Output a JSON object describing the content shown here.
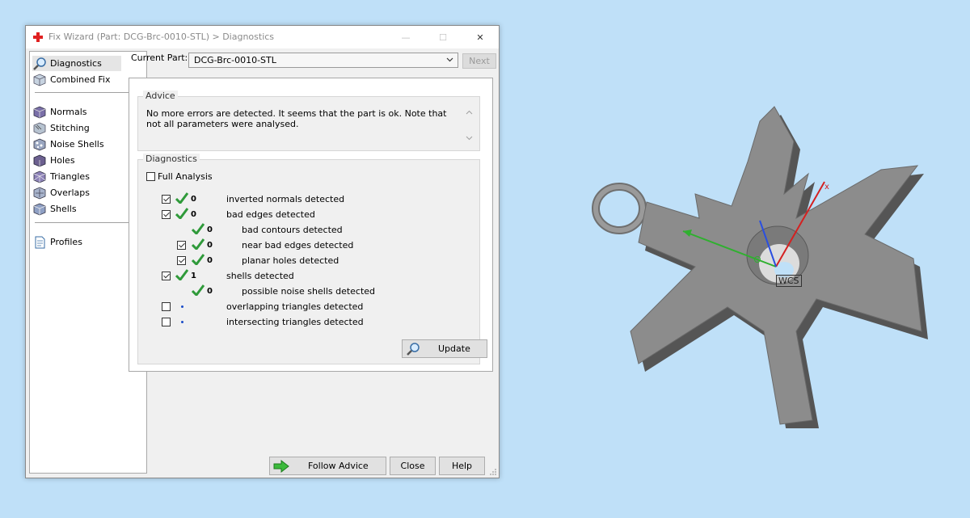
{
  "window": {
    "title": "Fix Wizard (Part: DCG-Brc-0010-STL) > Diagnostics",
    "minimize": "—",
    "maximize": "☐",
    "close": "✕"
  },
  "sidebar": {
    "items": [
      {
        "label": "Diagnostics",
        "icon": "magnifier-icon",
        "selected": true
      },
      {
        "label": "Combined Fix",
        "icon": "cube-icon"
      },
      {
        "label": "Normals",
        "icon": "cube-normals-icon"
      },
      {
        "label": "Stitching",
        "icon": "stitching-icon"
      },
      {
        "label": "Noise Shells",
        "icon": "noise-shells-icon"
      },
      {
        "label": "Holes",
        "icon": "holes-icon"
      },
      {
        "label": "Triangles",
        "icon": "triangles-icon"
      },
      {
        "label": "Overlaps",
        "icon": "overlaps-icon"
      },
      {
        "label": "Shells",
        "icon": "shells-icon"
      },
      {
        "label": "Profiles",
        "icon": "document-icon"
      }
    ]
  },
  "current_part": {
    "label": "Current Part:",
    "value": "DCG-Brc-0010-STL",
    "next_label": "Next"
  },
  "advice": {
    "title": "Advice",
    "text": "No more errors are detected. It seems that the part is ok. Note that not all parameters were analysed."
  },
  "diagnostics": {
    "title": "Diagnostics",
    "full_analysis_label": "Full Analysis",
    "rows": [
      {
        "label": "inverted normals detected",
        "count": "0",
        "checked": true
      },
      {
        "label": "bad edges detected",
        "count": "0",
        "checked": true
      },
      {
        "label": "bad contours detected",
        "count": "0",
        "checked": false
      },
      {
        "label": "near bad edges detected",
        "count": "0",
        "checked": true
      },
      {
        "label": "planar holes detected",
        "count": "0",
        "checked": true
      },
      {
        "label": "shells detected",
        "count": "1",
        "checked": true
      },
      {
        "label": "possible noise shells detected",
        "count": "0",
        "checked": false
      },
      {
        "label": "overlapping triangles detected",
        "count": "",
        "checked": false
      },
      {
        "label": "intersecting triangles detected",
        "count": "",
        "checked": false
      }
    ],
    "update_label": "Update"
  },
  "buttons": {
    "follow_advice": "Follow Advice",
    "close": "Close",
    "help": "Help"
  },
  "viewport": {
    "wcs_label": "WCS",
    "axis_x_label": "x",
    "colors": {
      "x_axis": "#d42020",
      "y_axis": "#2fb02f",
      "z_axis": "#2a4fe0",
      "part": "#8c8c8c"
    }
  }
}
